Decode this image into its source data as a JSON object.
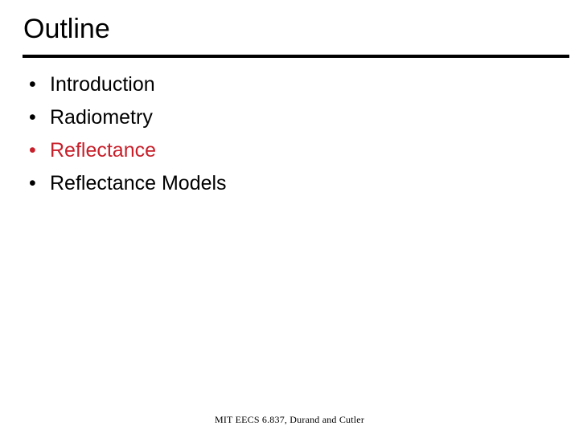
{
  "slide": {
    "title": "Outline",
    "accent_color": "#c8202b",
    "text_color": "#000000",
    "background_color": "#ffffff",
    "bullet_glyph": "•",
    "items": [
      {
        "label": "Introduction",
        "highlighted": false
      },
      {
        "label": "Radiometry",
        "highlighted": false
      },
      {
        "label": "Reflectance",
        "highlighted": true
      },
      {
        "label": "Reflectance Models",
        "highlighted": false
      }
    ],
    "footer": "MIT EECS 6.837, Durand and Cutler"
  }
}
